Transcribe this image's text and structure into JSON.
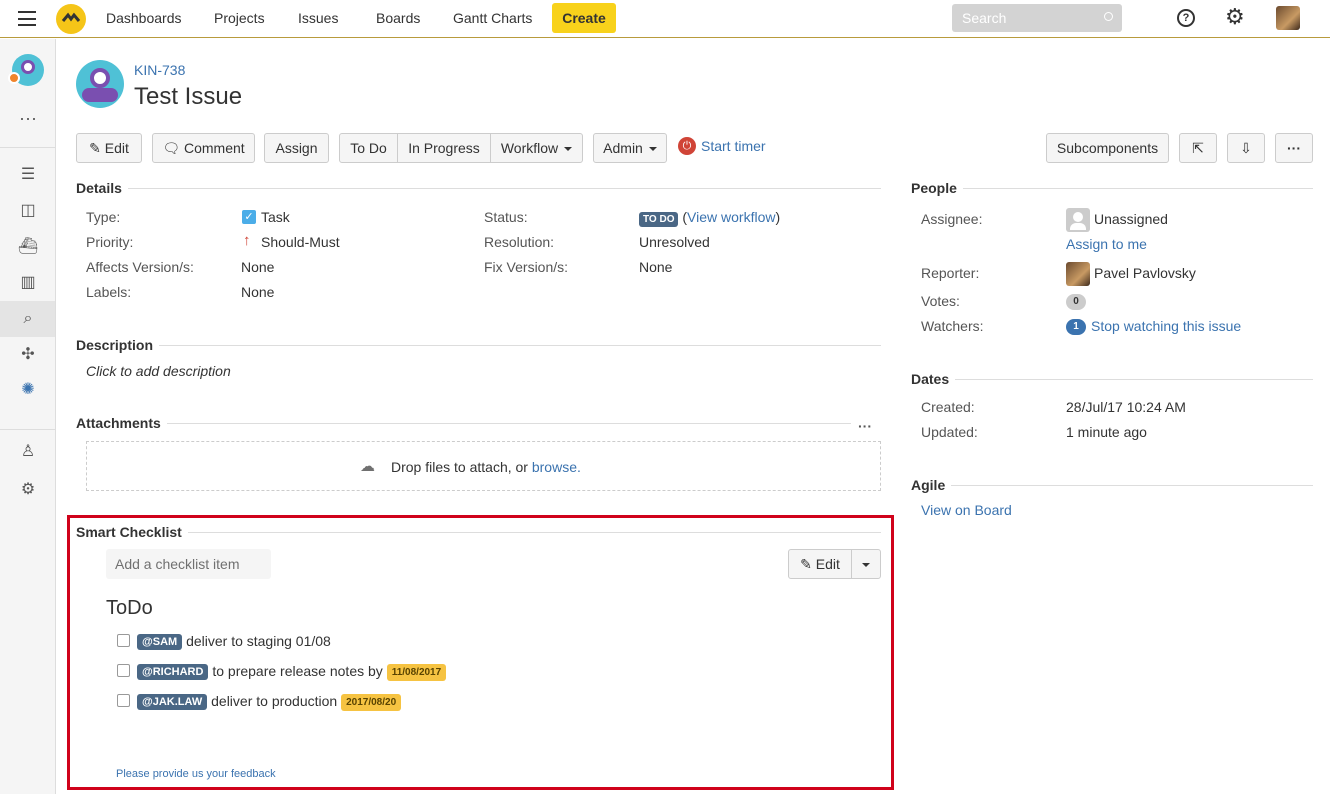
{
  "nav": {
    "items": [
      "Dashboards",
      "Projects",
      "Issues",
      "Boards",
      "Gantt Charts"
    ],
    "create": "Create",
    "search_placeholder": "Search"
  },
  "issue": {
    "key": "KIN-738",
    "title": "Test Issue"
  },
  "toolbar": {
    "edit": "Edit",
    "comment": "Comment",
    "assign": "Assign",
    "todo": "To Do",
    "in_progress": "In Progress",
    "workflow": "Workflow",
    "admin": "Admin",
    "start_timer": "Start timer",
    "subcomponents": "Subcomponents"
  },
  "details": {
    "title": "Details",
    "type_label": "Type:",
    "type_value": "Task",
    "priority_label": "Priority:",
    "priority_value": "Should-Must",
    "affects_label": "Affects Version/s:",
    "affects_value": "None",
    "labels_label": "Labels:",
    "labels_value": "None",
    "status_label": "Status:",
    "status_value": "TO DO",
    "view_workflow": "View workflow",
    "resolution_label": "Resolution:",
    "resolution_value": "Unresolved",
    "fix_label": "Fix Version/s:",
    "fix_value": "None"
  },
  "description": {
    "title": "Description",
    "placeholder": "Click to add description"
  },
  "attachments": {
    "title": "Attachments",
    "drop_text": "Drop files to attach, or",
    "browse": "browse."
  },
  "checklist": {
    "title": "Smart Checklist",
    "add_placeholder": "Add a checklist item",
    "edit": "Edit",
    "heading": "ToDo",
    "items": [
      {
        "tag": "@SAM",
        "text": "deliver to staging 01/08",
        "date": ""
      },
      {
        "tag": "@RICHARD",
        "text": "to prepare release notes by",
        "date": "11/08/2017"
      },
      {
        "tag": "@JAK.LAW",
        "text": "deliver to production",
        "date": "2017/08/20"
      }
    ],
    "feedback": "Please provide us your feedback"
  },
  "people": {
    "title": "People",
    "assignee_label": "Assignee:",
    "assignee_value": "Unassigned",
    "assign_to_me": "Assign to me",
    "reporter_label": "Reporter:",
    "reporter_value": "Pavel Pavlovsky",
    "votes_label": "Votes:",
    "votes_value": "0",
    "watchers_label": "Watchers:",
    "watchers_count": "1",
    "watchers_link": "Stop watching this issue"
  },
  "dates": {
    "title": "Dates",
    "created_label": "Created:",
    "created_value": "28/Jul/17 10:24 AM",
    "updated_label": "Updated:",
    "updated_value": "1 minute ago"
  },
  "agile": {
    "title": "Agile",
    "link": "View on Board"
  },
  "colors": {
    "create": "#f8d21b",
    "link": "#3b73af",
    "highlight_border": "#d0021b",
    "lozenge": "#4a6785",
    "date_tag": "#f6c342"
  }
}
